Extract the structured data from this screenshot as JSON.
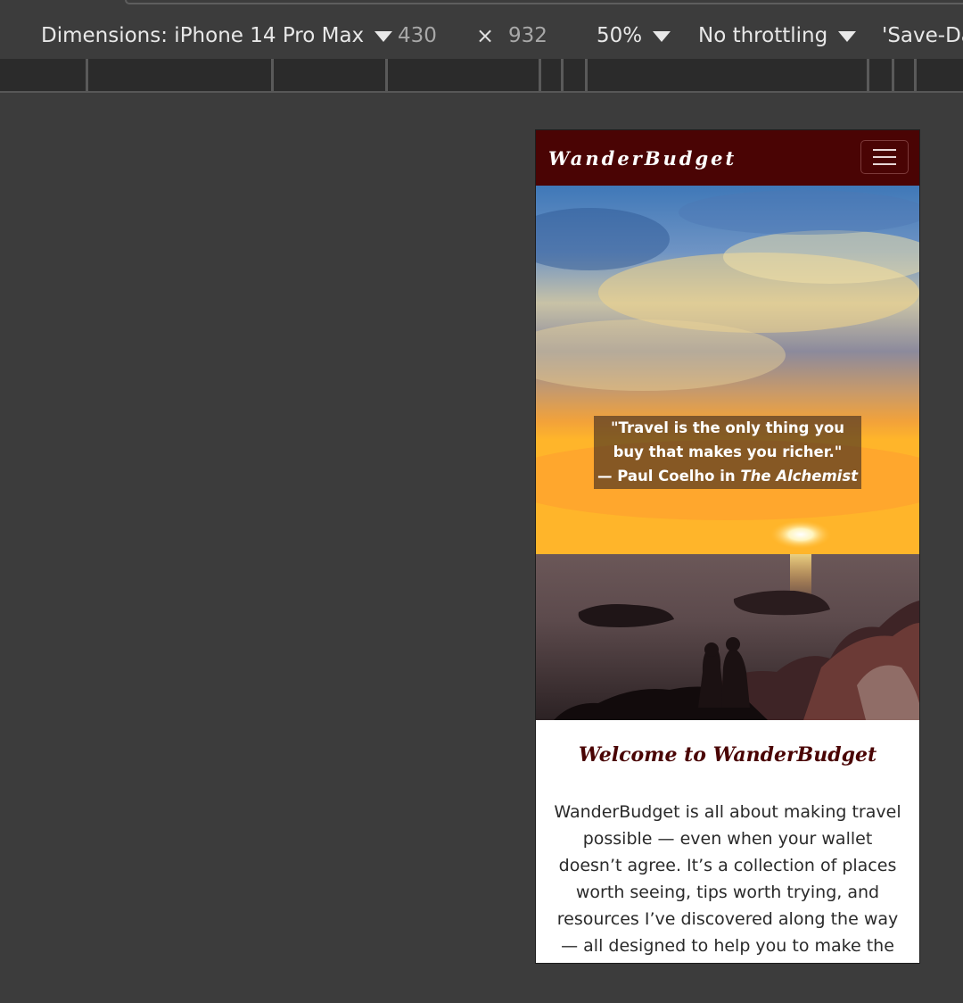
{
  "devtools": {
    "dimensions_label": "Dimensions: iPhone 14 Pro Max",
    "width": "430",
    "times": "×",
    "height": "932",
    "zoom": "50%",
    "throttling": "No throttling",
    "save_data": "'Save-Da"
  },
  "site": {
    "brand": "WanderBudget",
    "hero": {
      "quote": "\"Travel is the only thing you buy that makes you richer.\"",
      "attribution": "—  Paul Coelho in ",
      "book": "The Alchemist"
    },
    "welcome": {
      "title": "Welcome to WanderBudget",
      "text": "WanderBudget is all about making travel possible — even when your wallet doesn’t agree. It’s a collection of places worth seeing, tips worth trying, and resources I’ve discovered along the way — all designed to help you to make the most of"
    }
  },
  "colors": {
    "navbar": "#4a0404",
    "welcome_title": "#4a0404",
    "devtools_bg": "#3c3c3c"
  },
  "icons": {
    "menu": "hamburger-icon",
    "dropdown": "triangle-down-icon"
  }
}
